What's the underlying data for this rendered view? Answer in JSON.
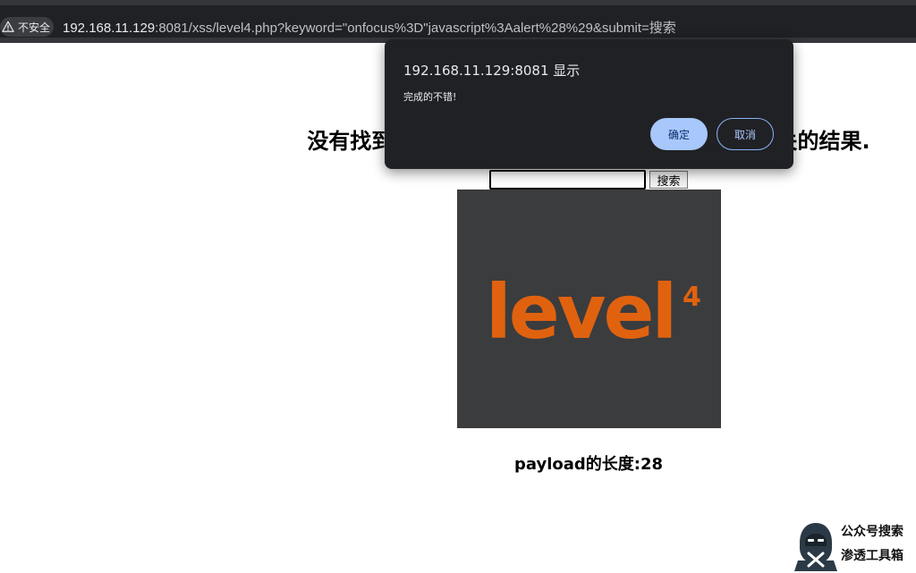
{
  "address_bar": {
    "security_label": "不安全",
    "url_host": "192.168.11.129",
    "url_rest": ":8081/xss/level4.php?keyword=\"onfocus%3D\"javascript%3Aalert%28%29&submit=搜索"
  },
  "page": {
    "heading": "没有找到和\"onfocus=\"javascript:alert()相关的结果.",
    "search_input_value": "",
    "search_button_label": "搜索",
    "logo_text": "level",
    "logo_superscript": "4",
    "payload_length": "payload的长度:28"
  },
  "dialog": {
    "title": "192.168.11.129:8081 显示",
    "message": "完成的不错!",
    "ok_label": "确定",
    "cancel_label": "取消"
  },
  "watermark": {
    "line1": "公众号搜索",
    "line2": "渗透工具箱"
  },
  "colors": {
    "logo_orange": "#e0620f",
    "logo_bg": "#3b3c3e",
    "dialog_bg": "#202124",
    "ok_button": "#a8c7fa"
  }
}
